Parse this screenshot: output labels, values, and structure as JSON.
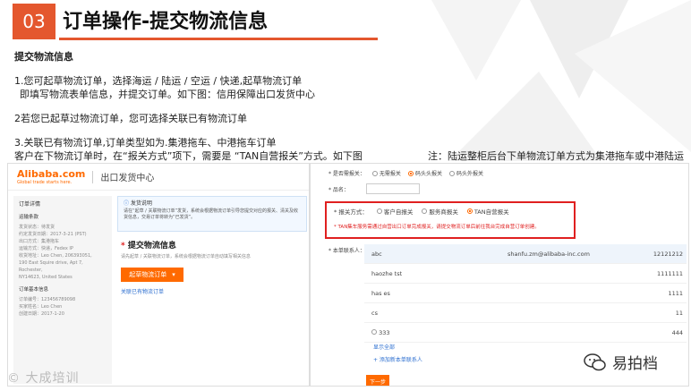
{
  "slide": {
    "number": "03",
    "title": "订单操作-提交物流信息",
    "subtitle": "提交物流信息",
    "line1a": "1.您可起草物流订单，选择海运 / 陆运 / 空运 / 快递,起草物流订单",
    "line1b": "即填写物流表单信息，并提交订单。如下图：信用保障出口发货中心",
    "line2": "2若您已起草过物流订单，您可选择关联已有物流订单",
    "line3a": "3.关联已有物流订单,订单类型如为.集港拖车、中港拖车订单",
    "line3b": "客户在下物流订单时，在“报关方式”项下，需要是 “TAN自营报关”方式。如下图",
    "note": "注：陆运整柜后台下单物流订单方式为集港拖车或中港陆运"
  },
  "left_shot": {
    "logo": "Alibaba.com",
    "logo_sub": "Global trade starts here.",
    "header": "出口发货中心",
    "sidebar": {
      "title": "订单详情",
      "sec1": "运输条款",
      "items1": [
        "发货状态：待发货",
        "约定发货日期：2017-3-21 (PST)",
        "出口方式：集港拖车",
        "运输方式：快递，Fedex IP",
        "收货地址：Leo Chen, 206393051,",
        "190 East Squire drive, Apt 7, Rochester,",
        "NY14623, United States"
      ],
      "sec2": "订单基本信息",
      "items2": [
        "订单编号：123456789098",
        "买家姓名：Leo Chen",
        "创建日期：2017-1-20"
      ]
    },
    "notice_title": "发货说明",
    "notice_body": "请在“起草 / 关联物流订单”发货，系统会根据物流订单引导您提交对应的报关、清关及收货信息，交易订单将转为“已发货”。",
    "submit_title": "提交物流信息",
    "submit_desc": "请先起草 / 关联物流订单，系统会根据物流订单自动填写相关信息",
    "draft_button": "起草物流订单",
    "link_assoc": "关联已有物流订单"
  },
  "right_shot": {
    "row1_label": "* 是否需报关：",
    "row1_options": [
      "无需报关",
      "码头头报关",
      "码头外报关"
    ],
    "name_label": "* 品名：",
    "customs_label": "* 报关方式：",
    "customs_options": [
      "客户自报关",
      "服务商报关",
      "TAN自营报关"
    ],
    "warning": "* TAN集车服务需通过自营出口订单完成报关，请提交物流订单后前往我台完成自营订单创建。",
    "contact_label": "* 本单联系人：",
    "contacts": [
      {
        "name": "abc",
        "email": "shanfu.zm@alibaba-inc.com",
        "phone": "12121212"
      },
      {
        "name": "haozhe tst",
        "email": "",
        "phone": "1111111"
      },
      {
        "name": "has es",
        "email": "",
        "phone": "1111"
      },
      {
        "name": "cs",
        "email": "",
        "phone": "11"
      },
      {
        "name": "333",
        "email": "",
        "phone": "444"
      }
    ],
    "show_all": "显示全部",
    "add_contact": "+ 添加新本单联系人",
    "next_button": "下一步"
  },
  "watermark": "大成培训",
  "brand": "易拍档"
}
